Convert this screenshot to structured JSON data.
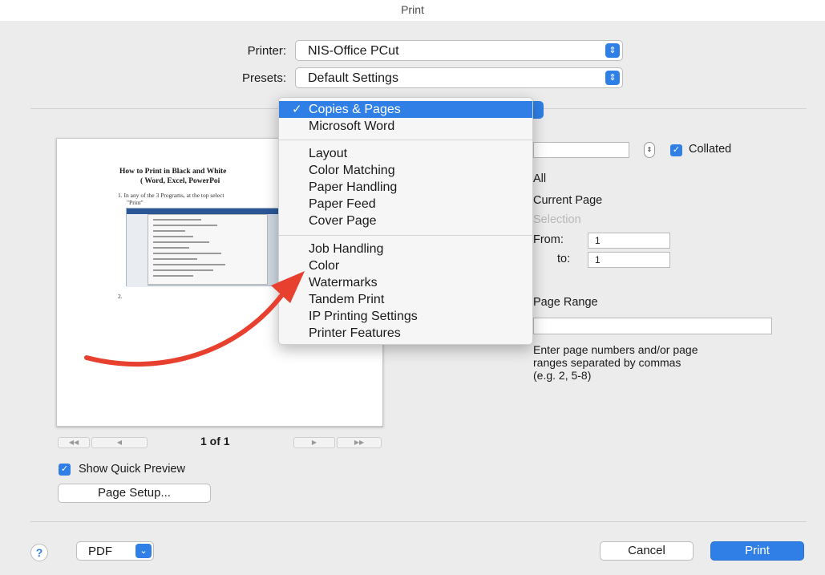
{
  "window": {
    "title": "Print"
  },
  "printer": {
    "label": "Printer:",
    "value": "NIS-Office PCut"
  },
  "presets": {
    "label": "Presets:",
    "value": "Default Settings"
  },
  "section_menu": {
    "selected": "Copies & Pages",
    "groups": [
      [
        "Copies & Pages",
        "Microsoft Word"
      ],
      [
        "Layout",
        "Color Matching",
        "Paper Handling",
        "Paper Feed",
        "Cover Page"
      ],
      [
        "Job Handling",
        "Color",
        "Watermarks",
        "Tandem Print",
        "IP Printing Settings",
        "Printer Features"
      ]
    ]
  },
  "preview": {
    "doc_title": "How to Print in Black and White",
    "doc_subtitle": "( Word, Excel, PowerPoi",
    "doc_line1": "1. In any of the 3 Programs, at the top select",
    "doc_line2": "\"Print\"",
    "doc_line3": "2.",
    "page_count": "1 of 1"
  },
  "copies": {
    "collated_label": "Collated",
    "collated_checked": true
  },
  "pages": {
    "all_label": "All",
    "current_page_label": "Current Page",
    "selection_label": "Selection",
    "from_label": "From:",
    "from_value": "1",
    "to_label": "to:",
    "to_value": "1",
    "page_range_label": "Page Range",
    "page_range_value": "",
    "hint": [
      "Enter page numbers and/or page",
      "ranges separated by commas",
      "(e.g. 2, 5-8)"
    ]
  },
  "show_quick_preview": {
    "label": "Show Quick Preview",
    "checked": true
  },
  "buttons": {
    "page_setup": "Page Setup...",
    "pdf": "PDF",
    "cancel": "Cancel",
    "print": "Print",
    "help": "?"
  },
  "colors": {
    "accent": "#2f7fe6",
    "arrow": "#e8402f"
  }
}
